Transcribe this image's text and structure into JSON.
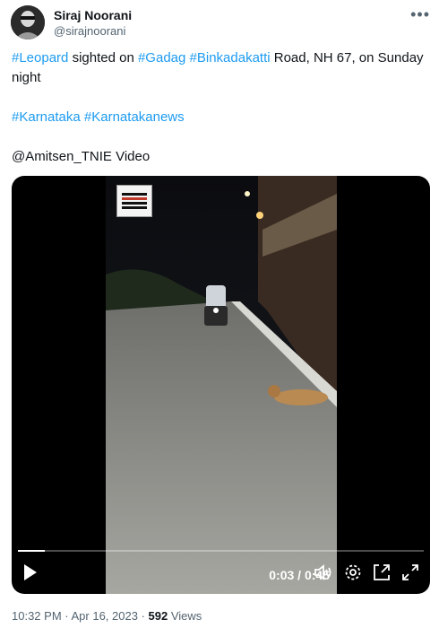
{
  "author": {
    "display_name": "Siraj Noorani",
    "handle": "@sirajnoorani"
  },
  "more_icon": "more-horizontal-icon",
  "tweet": {
    "line1": {
      "hashtag_leopard": "#Leopard",
      "text_sighted": " sighted on ",
      "hashtag_gadag": "#Gadag",
      "hashtag_binkadakatti": "#Binkadakatti",
      "text_rest": " Road, NH 67, on Sunday night"
    },
    "line2": {
      "hashtag_karnataka": "#Karnataka",
      "hashtag_karnatakanews": "#Karnatakanews"
    },
    "line3": "@Amitsen_TNIE Video"
  },
  "video": {
    "time_current": "0:03",
    "time_separator": " / ",
    "time_total": "0:45",
    "progress_fraction": 0.067,
    "icons": {
      "play": "play-icon",
      "volume": "volume-icon",
      "settings": "settings-icon",
      "pip": "picture-in-picture-icon",
      "fullscreen": "fullscreen-icon"
    }
  },
  "footer": {
    "time": "10:32 PM",
    "dot1": " · ",
    "date": "Apr 16, 2023",
    "dot2": " · ",
    "views_count": "592",
    "views_label": " Views"
  },
  "colors": {
    "link": "#1d9bf0",
    "text": "#0f1419",
    "muted": "#536471"
  }
}
